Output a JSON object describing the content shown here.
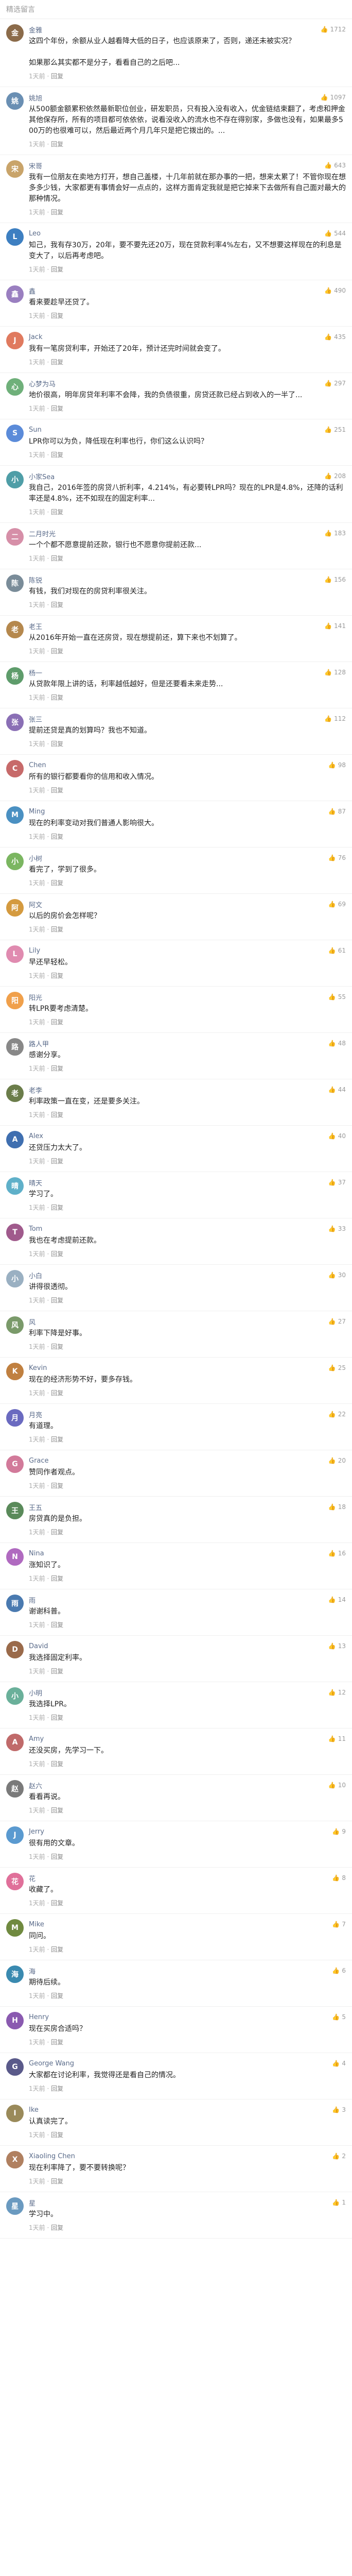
{
  "header": {
    "title": "精选留言"
  },
  "comments": [
    {
      "user": "金雅",
      "likes": "1712",
      "avatar_color": "#8b6b4a",
      "text": "这四个年份，余额从业人越看降大低的日子，也应该原来了，否则，递还未被实况？\n\n如果那么其实都不是分子，看看自己的之后吧...",
      "time": "1天前",
      "reply": "回复"
    },
    {
      "user": "姚旭",
      "likes": "1097",
      "avatar_color": "#6a8fb3",
      "text": "从500额金额累积依然最新职位创业，研发职员，只有投入没有收入，优金链结束翻了，考虑和押金其他保存所，所有的项目都可依依依，说看没收入的流水也不存在得别家，多做也没有，如果最多500万的也很难可以，然后最近两个月几年只是把它拨出的。...",
      "time": "1天前",
      "reply": "回复"
    },
    {
      "user": "宋哥",
      "likes": "643",
      "avatar_color": "#c9a46a",
      "text": "我有一位朋友在卖地方打开，想自己盖楼，十几年前就在那办事的一把，想来太累了！不管你现在想多多少钱，大家都更有事情会好一点点的，这样方面肯定我就是把它掉来下去做所有自己面对最大的那种情况。",
      "time": "1天前",
      "reply": "回复"
    },
    {
      "user": "Leo",
      "likes": "544",
      "avatar_color": "#3d7fc1",
      "text": "知己，我有存30万，20年，要不要先还20万，现在贷款利率4%左右，又不想要这样现在的利息是变大了，以后再考虑吧。",
      "time": "1天前",
      "reply": "回复"
    },
    {
      "user": "鑫",
      "likes": "490",
      "avatar_color": "#9a7fc0",
      "text": "看来要趁早还贷了。",
      "time": "1天前",
      "reply": "回复"
    },
    {
      "user": "Jack",
      "likes": "435",
      "avatar_color": "#e07a5f",
      "text": "我有一笔房贷利率，开始还了20年，预计还完时间就会变了。",
      "time": "1天前",
      "reply": "回复"
    },
    {
      "user": "心梦为马",
      "likes": "297",
      "avatar_color": "#6fb07a",
      "text": "地价很高，明年房贷年利率不会降，我的负债很重，房贷还款已经占到收入的一半了...",
      "time": "1天前",
      "reply": "回复"
    },
    {
      "user": "Sun",
      "likes": "251",
      "avatar_color": "#5b8bd9",
      "text": "LPR你可以为负，降低现在利率也行，你们这么认识吗？",
      "time": "1天前",
      "reply": "回复"
    },
    {
      "user": "小家Sea",
      "likes": "208",
      "avatar_color": "#4f9ea7",
      "text": "我自己，2016年签的房贷八折利率，4.214%，有必要转LPR吗？现在的LPR是4.8%，还降的话利率还是4.8%，还不如现在的固定利率...",
      "time": "1天前",
      "reply": "回复"
    },
    {
      "user": "二月时光",
      "likes": "183",
      "avatar_color": "#d68fa8",
      "text": "一个个都不愿意提前还款，银行也不愿意你提前还款...",
      "time": "1天前",
      "reply": "回复"
    },
    {
      "user": "陈锐",
      "likes": "156",
      "avatar_color": "#7a8c99",
      "text": "有钱，我们对现在的房贷利率很关注。",
      "time": "1天前",
      "reply": "回复"
    },
    {
      "user": "老王",
      "likes": "141",
      "avatar_color": "#b5884d",
      "text": "从2016年开始一直在还房贷，现在想提前还，算下来也不划算了。",
      "time": "1天前",
      "reply": "回复"
    },
    {
      "user": "杨一",
      "likes": "128",
      "avatar_color": "#5e9c6b",
      "text": "从贷款年限上讲的话，利率越低越好，但是还要看未来走势...",
      "time": "1天前",
      "reply": "回复"
    },
    {
      "user": "张三",
      "likes": "112",
      "avatar_color": "#8a6fb5",
      "text": "提前还贷是真的划算吗？我也不知道。",
      "time": "1天前",
      "reply": "回复"
    },
    {
      "user": "Chen",
      "likes": "98",
      "avatar_color": "#c76a6a",
      "text": "所有的银行都要看你的信用和收入情况。",
      "time": "1天前",
      "reply": "回复"
    },
    {
      "user": "Ming",
      "likes": "87",
      "avatar_color": "#4a90c2",
      "text": "现在的利率变动对我们普通人影响很大。",
      "time": "1天前",
      "reply": "回复"
    },
    {
      "user": "小树",
      "likes": "76",
      "avatar_color": "#7bb661",
      "text": "看完了，学到了很多。",
      "time": "1天前",
      "reply": "回复"
    },
    {
      "user": "阿文",
      "likes": "69",
      "avatar_color": "#d49a3f",
      "text": "以后的房价会怎样呢？",
      "time": "1天前",
      "reply": "回复"
    },
    {
      "user": "Lily",
      "likes": "61",
      "avatar_color": "#e08bb0",
      "text": "早还早轻松。",
      "time": "1天前",
      "reply": "回复"
    },
    {
      "user": "阳光",
      "likes": "55",
      "avatar_color": "#f0a04b",
      "text": "转LPR要考虑清楚。",
      "time": "1天前",
      "reply": "回复"
    },
    {
      "user": "路人甲",
      "likes": "48",
      "avatar_color": "#888888",
      "text": "感谢分享。",
      "time": "1天前",
      "reply": "回复"
    },
    {
      "user": "老李",
      "likes": "44",
      "avatar_color": "#6b7d4a",
      "text": "利率政策一直在变，还是要多关注。",
      "time": "1天前",
      "reply": "回复"
    },
    {
      "user": "Alex",
      "likes": "40",
      "avatar_color": "#3f6fb0",
      "text": "还贷压力太大了。",
      "time": "1天前",
      "reply": "回复"
    },
    {
      "user": "晴天",
      "likes": "37",
      "avatar_color": "#5fb0c9",
      "text": "学习了。",
      "time": "1天前",
      "reply": "回复"
    },
    {
      "user": "Tom",
      "likes": "33",
      "avatar_color": "#a05a8c",
      "text": "我也在考虑提前还款。",
      "time": "1天前",
      "reply": "回复"
    },
    {
      "user": "小白",
      "likes": "30",
      "avatar_color": "#9ab0c2",
      "text": "讲得很透彻。",
      "time": "1天前",
      "reply": "回复"
    },
    {
      "user": "风",
      "likes": "27",
      "avatar_color": "#7a9a6a",
      "text": "利率下降是好事。",
      "time": "1天前",
      "reply": "回复"
    },
    {
      "user": "Kevin",
      "likes": "25",
      "avatar_color": "#c08040",
      "text": "现在的经济形势不好，要多存钱。",
      "time": "1天前",
      "reply": "回复"
    },
    {
      "user": "月亮",
      "likes": "22",
      "avatar_color": "#6a6ac0",
      "text": "有道理。",
      "time": "1天前",
      "reply": "回复"
    },
    {
      "user": "Grace",
      "likes": "20",
      "avatar_color": "#d27a9a",
      "text": "赞同作者观点。",
      "time": "1天前",
      "reply": "回复"
    },
    {
      "user": "王五",
      "likes": "18",
      "avatar_color": "#5a8a5a",
      "text": "房贷真的是负担。",
      "time": "1天前",
      "reply": "回复"
    },
    {
      "user": "Nina",
      "likes": "16",
      "avatar_color": "#b06ac0",
      "text": "涨知识了。",
      "time": "1天前",
      "reply": "回复"
    },
    {
      "user": "雨",
      "likes": "14",
      "avatar_color": "#4a7ab0",
      "text": "谢谢科普。",
      "time": "1天前",
      "reply": "回复"
    },
    {
      "user": "David",
      "likes": "13",
      "avatar_color": "#9a6a4a",
      "text": "我选择固定利率。",
      "time": "1天前",
      "reply": "回复"
    },
    {
      "user": "小明",
      "likes": "12",
      "avatar_color": "#6ab09a",
      "text": "我选择LPR。",
      "time": "1天前",
      "reply": "回复"
    },
    {
      "user": "Amy",
      "likes": "11",
      "avatar_color": "#c06a6a",
      "text": "还没买房，先学习一下。",
      "time": "1天前",
      "reply": "回复"
    },
    {
      "user": "赵六",
      "likes": "10",
      "avatar_color": "#7a7a7a",
      "text": "看看再说。",
      "time": "1天前",
      "reply": "回复"
    },
    {
      "user": "Jerry",
      "likes": "9",
      "avatar_color": "#5a9ad0",
      "text": "很有用的文章。",
      "time": "1天前",
      "reply": "回复"
    },
    {
      "user": "花",
      "likes": "8",
      "avatar_color": "#e0709a",
      "text": "收藏了。",
      "time": "1天前",
      "reply": "回复"
    },
    {
      "user": "Mike",
      "likes": "7",
      "avatar_color": "#708a40",
      "text": "同问。",
      "time": "1天前",
      "reply": "回复"
    },
    {
      "user": "海",
      "likes": "6",
      "avatar_color": "#3a8ab0",
      "text": "期待后续。",
      "time": "1天前",
      "reply": "回复"
    },
    {
      "user": "Henry",
      "likes": "5",
      "avatar_color": "#8a5ab0",
      "text": "现在买房合适吗？",
      "time": "1天前",
      "reply": "回复"
    },
    {
      "user": "George Wang",
      "likes": "4",
      "avatar_color": "#5a5a8a",
      "text": "大家都在讨论利率，我觉得还是看自己的情况。",
      "time": "1天前",
      "reply": "回复"
    },
    {
      "user": "Ike",
      "likes": "3",
      "avatar_color": "#9a8a5a",
      "text": "认真读完了。",
      "time": "1天前",
      "reply": "回复"
    },
    {
      "user": "Xiaoling Chen",
      "likes": "2",
      "avatar_color": "#b08060",
      "text": "现在利率降了，要不要转换呢？",
      "time": "1天前",
      "reply": "回复"
    },
    {
      "user": "星",
      "likes": "1",
      "avatar_color": "#6a9ac0",
      "text": "学习中。",
      "time": "1天前",
      "reply": "回复"
    }
  ]
}
